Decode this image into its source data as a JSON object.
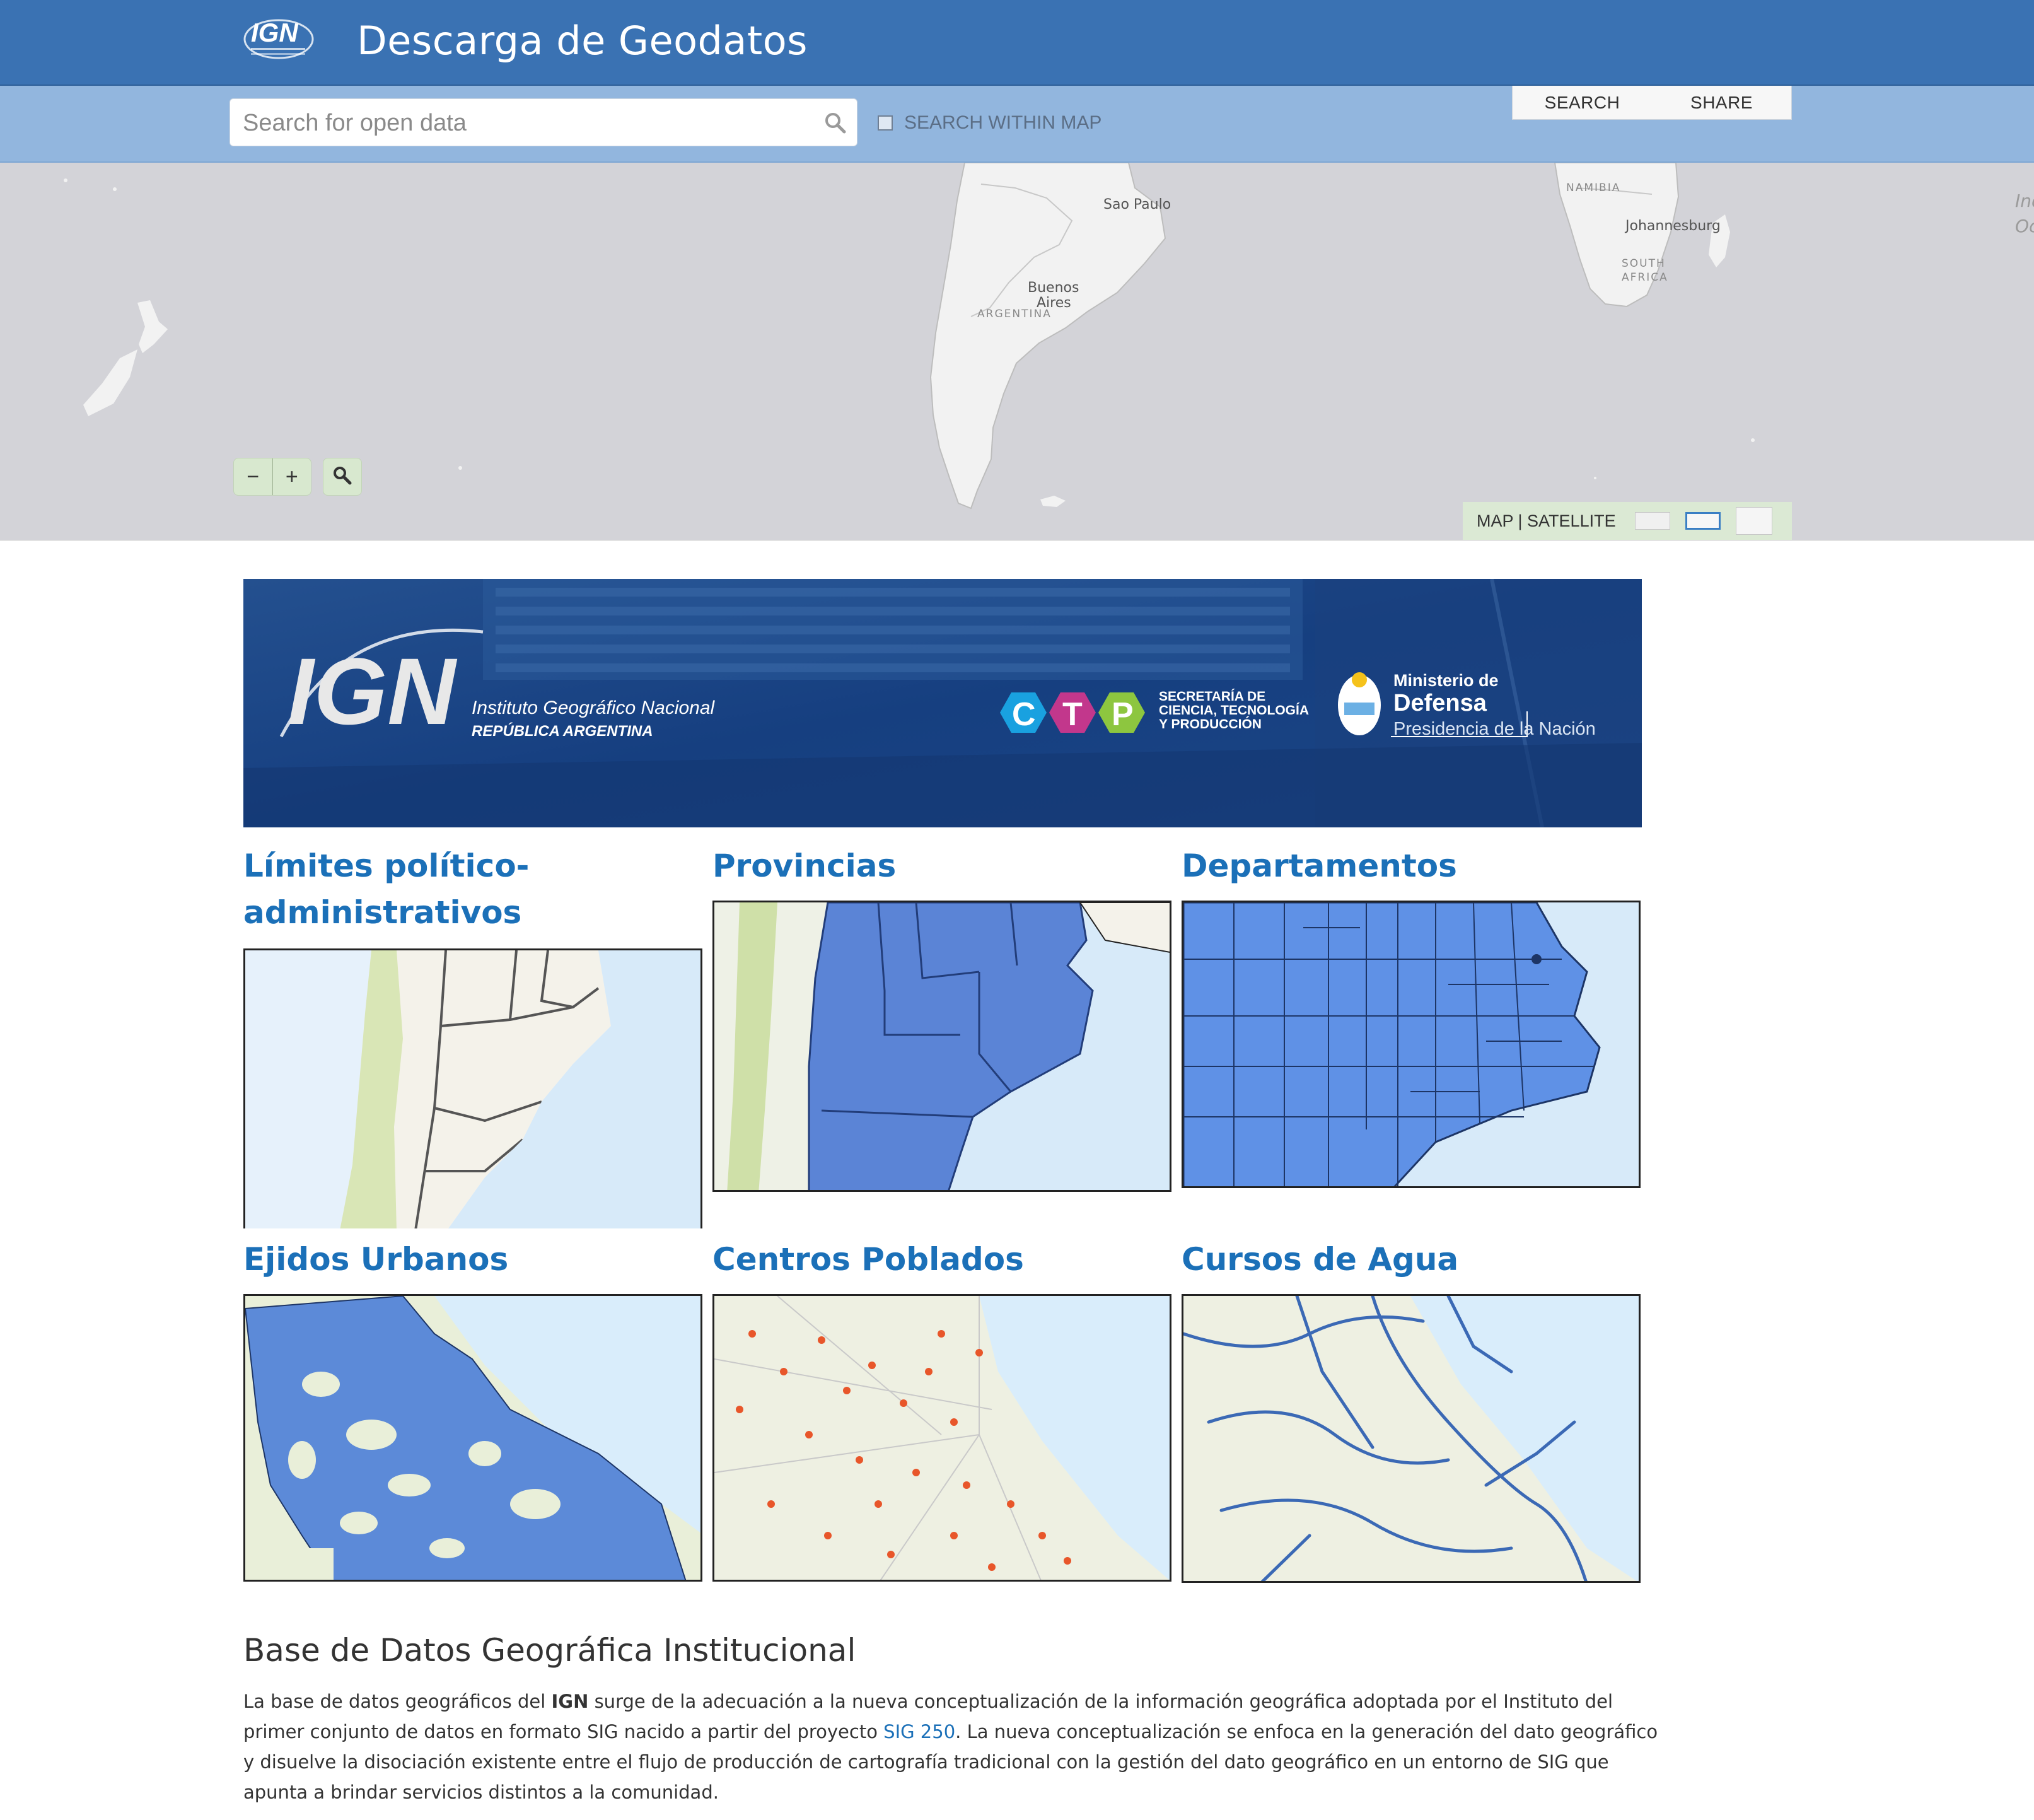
{
  "header": {
    "logo_text": "IGN",
    "title": "Descarga de Geodatos"
  },
  "search": {
    "placeholder": "Search for open data",
    "within_map_label": "SEARCH WITHIN MAP",
    "within_map_checked": false,
    "actions": [
      "SEARCH",
      "SHARE"
    ]
  },
  "map": {
    "labels": {
      "sao_paulo": "Sao Paulo",
      "buenos_aires_1": "Buenos",
      "buenos_aires_2": "Aires",
      "argentina": "ARGENTINA",
      "namibia": "NAMIBIA",
      "johannesburg": "Johannesburg",
      "south_africa_1": "SOUTH",
      "south_africa_2": "AFRICA",
      "edge_1": "Ind",
      "edge_2": "Oc"
    },
    "zoom_out": "−",
    "zoom_in": "+",
    "basemap_label": "MAP | SATELLITE",
    "colors": {
      "land": "#f2f2f2",
      "water": "#d3d3d8",
      "controls": "#d8e8cf"
    }
  },
  "banner": {
    "logo": "IGN",
    "institute_line1": "Instituto Geográfico Nacional",
    "institute_line2": "REPÚBLICA ARGENTINA",
    "ctp_letters": [
      "C",
      "T",
      "P"
    ],
    "ctp_line1": "SECRETARÍA DE",
    "ctp_line2": "CIENCIA, TECNOLOGÍA",
    "ctp_line3": "Y PRODUCCIÓN",
    "ministry_line1": "Ministerio de",
    "ministry_line2": "Defensa",
    "ministry_line3": "Presidencia de la Nación"
  },
  "datasets": [
    {
      "title_line1": "Límites político-",
      "title_line2": "administrativos"
    },
    {
      "title": "Provincias"
    },
    {
      "title": "Departamentos"
    },
    {
      "title": "Ejidos Urbanos"
    },
    {
      "title": "Centros Poblados"
    },
    {
      "title": "Cursos de Agua"
    }
  ],
  "about": {
    "heading": "Base de Datos Geográfica Institucional",
    "p1": "La base de datos geográficos del ",
    "ign": "IGN",
    "p2": " surge de la adecuación a la nueva conceptualización de la información geográfica adoptada por el Instituto del primer conjunto de datos en formato SIG nacido a partir del proyecto ",
    "link": "SIG 250",
    "p3": ". La nueva conceptualización se enfoca en la generación del dato geográfico y disuelve la disociación existente entre el flujo de producción de cartografía tradicional con la gestión del dato geográfico en un entorno de SIG que apunta a brindar servicios distintos a la comunidad."
  },
  "colors": {
    "header": "#3a72b3",
    "searchbar": "#92b6de",
    "link": "#1b70b8",
    "banner": "#173c7c"
  }
}
